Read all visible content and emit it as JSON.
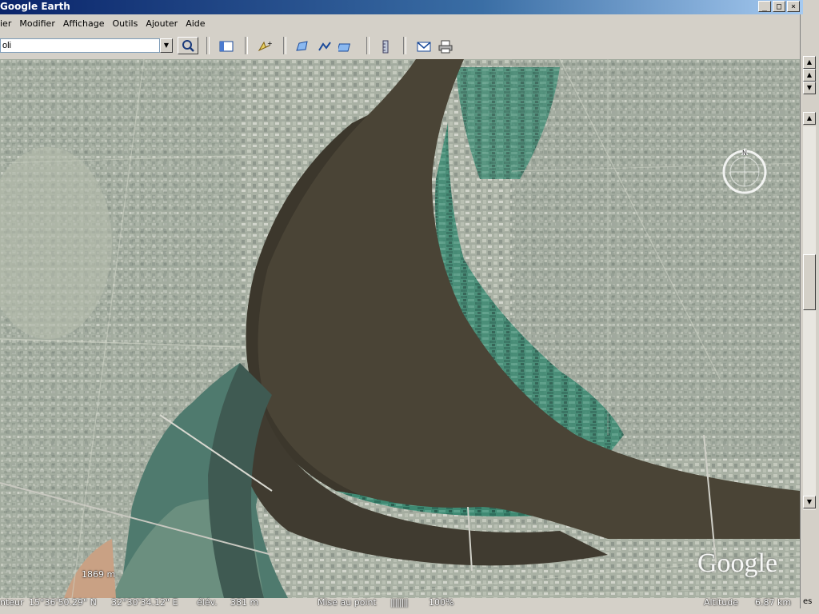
{
  "window": {
    "title": "Google Earth",
    "buttons": {
      "minimize": "_",
      "maximize": "□",
      "close": "×"
    }
  },
  "menu": {
    "items": [
      "ier",
      "Modifier",
      "Affichage",
      "Outils",
      "Ajouter",
      "Aide"
    ]
  },
  "toolbar": {
    "search_value": "oli"
  },
  "map": {
    "scale_label": "1869 m",
    "compass_letter": "N",
    "logo_text": "Google"
  },
  "status": {
    "pointer_label": "nteur",
    "lat": "15°36'50.29\" N",
    "lon": "32°30'34.12\" E",
    "elev_label": "élév.",
    "elev_value": "381 m",
    "focus_label": "Mise au point",
    "focus_bars": "||||||||",
    "focus_percent": "100%",
    "alt_label": "Altitude",
    "alt_value": "6.87 km",
    "corner_text": "es"
  }
}
